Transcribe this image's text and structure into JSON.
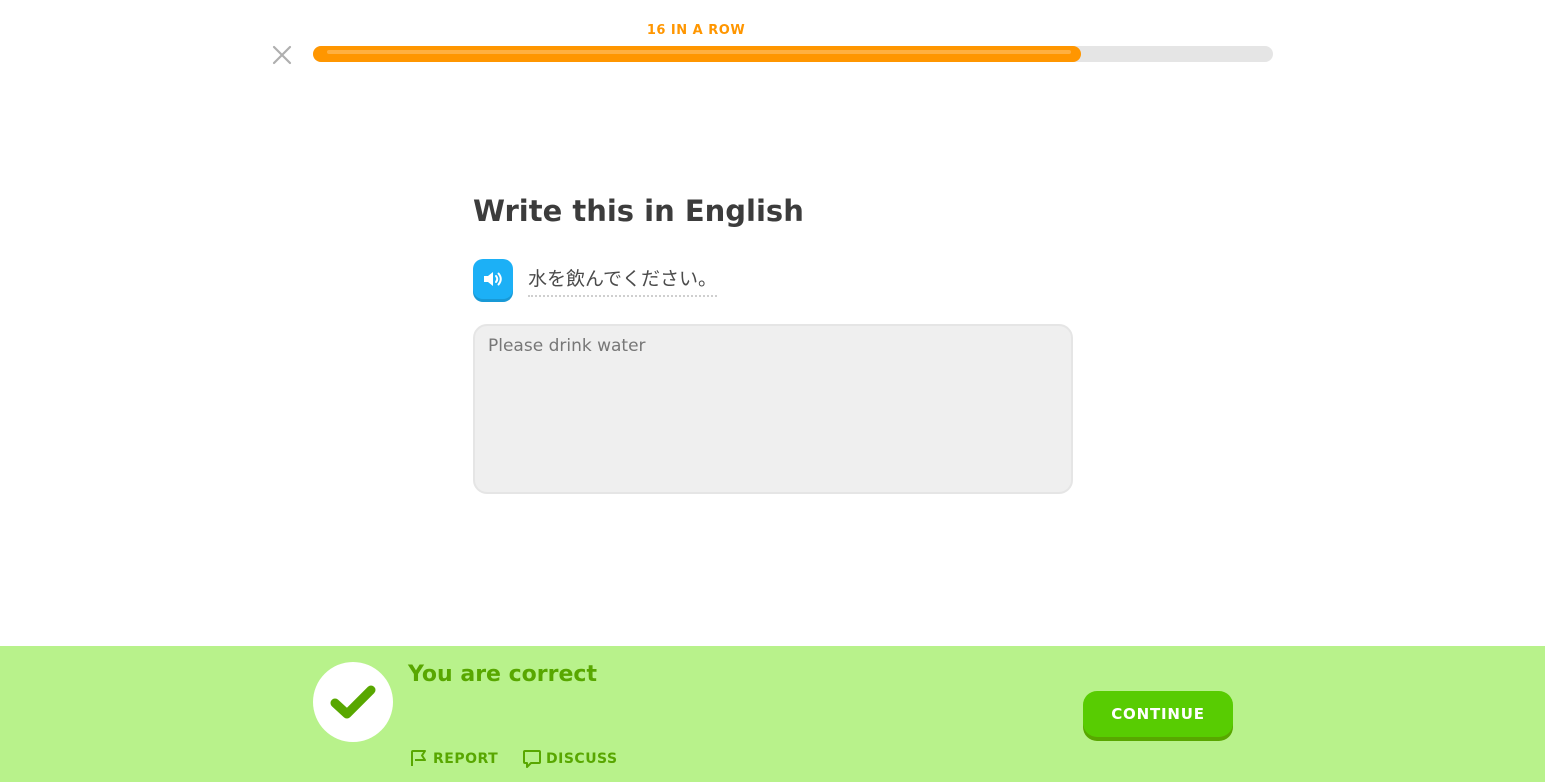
{
  "header": {
    "streak_label": "16 IN A ROW",
    "progress_fraction": 0.8,
    "progress_color": "#ff9600",
    "close_icon": "close-icon"
  },
  "challenge": {
    "title": "Write this in English",
    "prompt": "水を飲んでください。",
    "speaker_icon": "speaker-icon",
    "answer_text": "Please drink water"
  },
  "feedback": {
    "title": "You are correct",
    "status_icon": "checkmark-icon",
    "report_label": "REPORT",
    "report_icon": "flag-icon",
    "discuss_label": "DISCUSS",
    "discuss_icon": "speech-bubble-icon",
    "continue_label": "CONTINUE",
    "background_color": "#b8f28b",
    "accent_color": "#58a700",
    "button_color": "#58cc02"
  }
}
